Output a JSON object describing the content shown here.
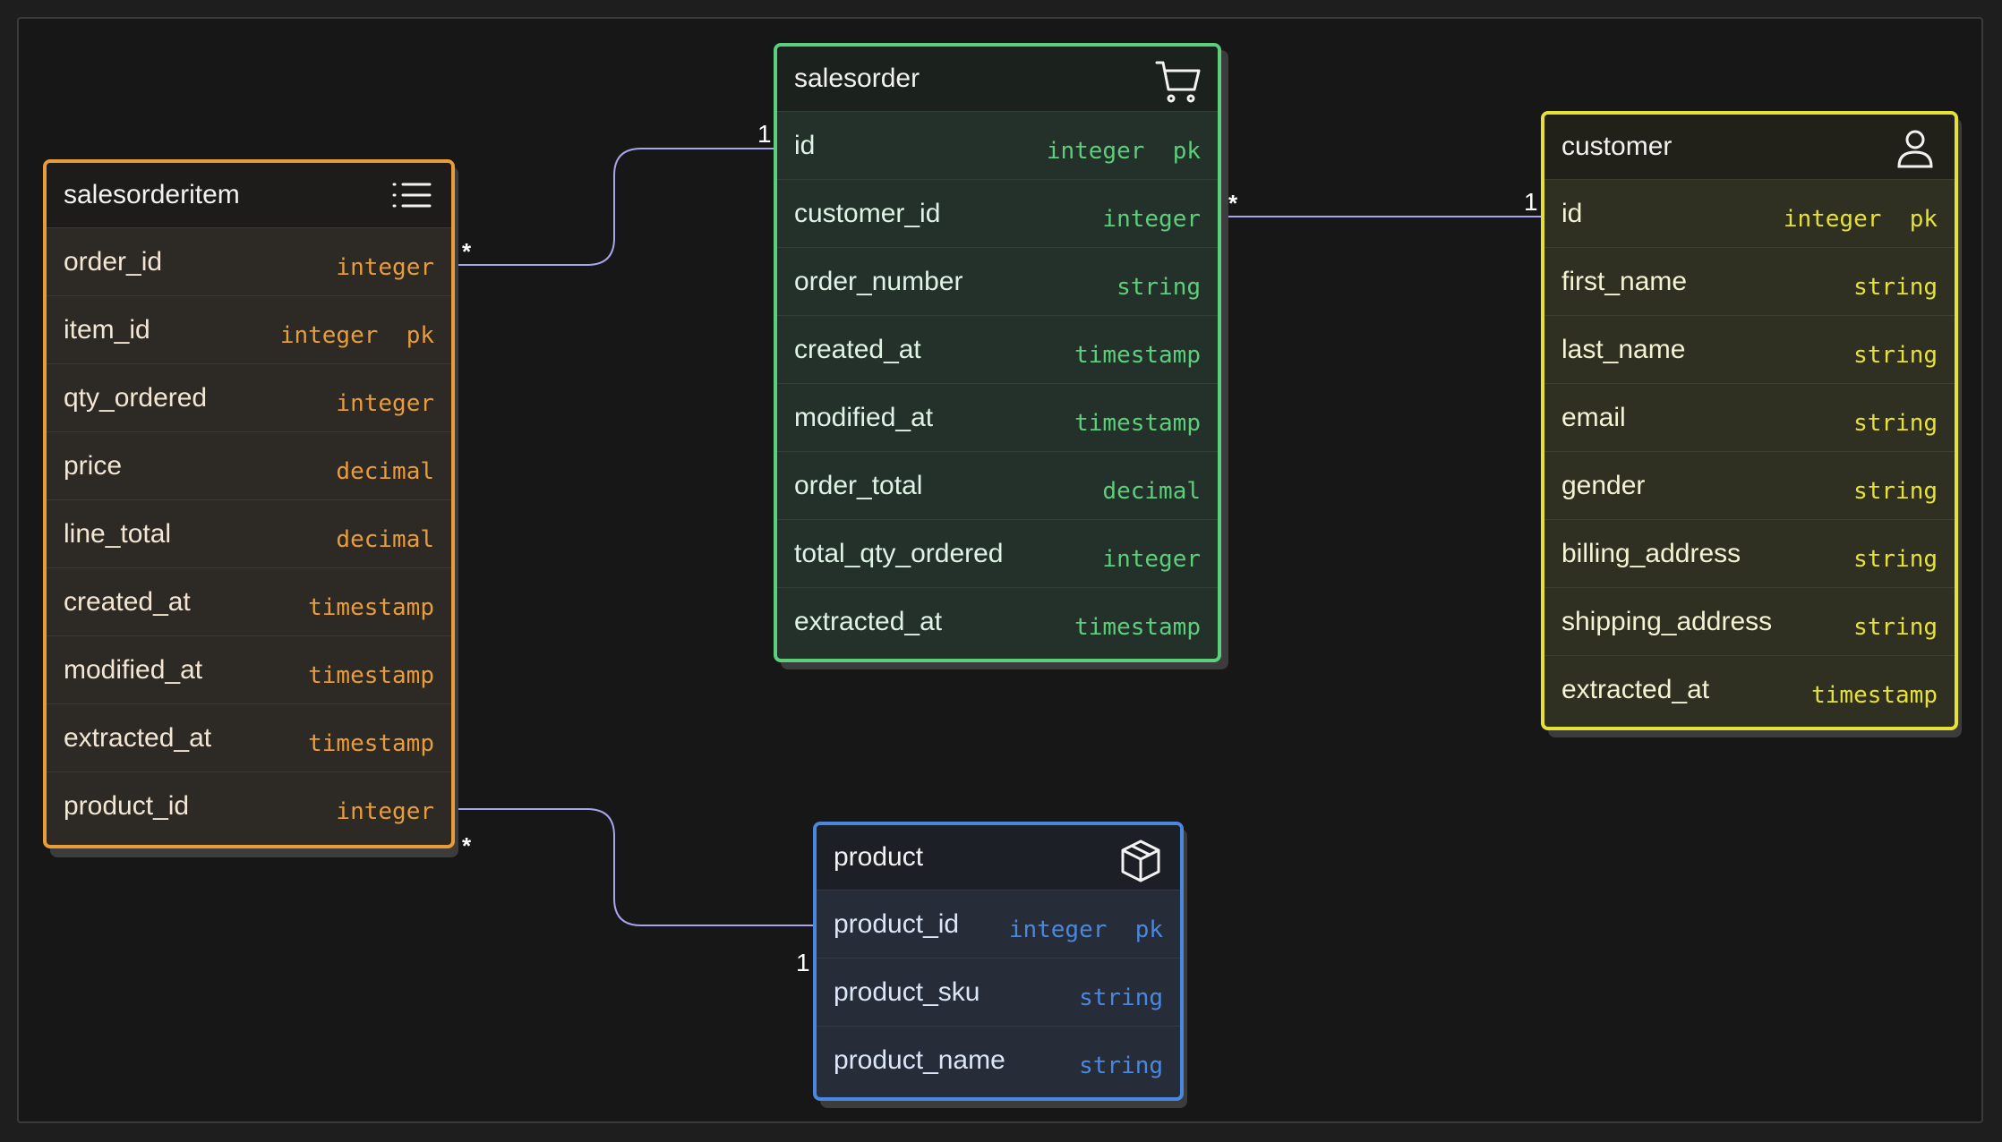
{
  "tables": {
    "salesorderitem": {
      "name": "salesorderitem",
      "icon": "list-icon",
      "color": "#e99c3a",
      "fields": [
        {
          "name": "order_id",
          "type": "integer"
        },
        {
          "name": "item_id",
          "type": "integer  pk"
        },
        {
          "name": "qty_ordered",
          "type": "integer"
        },
        {
          "name": "price",
          "type": "decimal"
        },
        {
          "name": "line_total",
          "type": "decimal"
        },
        {
          "name": "created_at",
          "type": "timestamp"
        },
        {
          "name": "modified_at",
          "type": "timestamp"
        },
        {
          "name": "extracted_at",
          "type": "timestamp"
        },
        {
          "name": "product_id",
          "type": "integer"
        }
      ]
    },
    "salesorder": {
      "name": "salesorder",
      "icon": "cart-icon",
      "color": "#5bcf79",
      "fields": [
        {
          "name": "id",
          "type": "integer  pk"
        },
        {
          "name": "customer_id",
          "type": "integer"
        },
        {
          "name": "order_number",
          "type": "string"
        },
        {
          "name": "created_at",
          "type": "timestamp"
        },
        {
          "name": "modified_at",
          "type": "timestamp"
        },
        {
          "name": "order_total",
          "type": "decimal"
        },
        {
          "name": "total_qty_ordered",
          "type": "integer"
        },
        {
          "name": "extracted_at",
          "type": "timestamp"
        }
      ]
    },
    "customer": {
      "name": "customer",
      "icon": "user-icon",
      "color": "#e6e235",
      "fields": [
        {
          "name": "id",
          "type": "integer  pk"
        },
        {
          "name": "first_name",
          "type": "string"
        },
        {
          "name": "last_name",
          "type": "string"
        },
        {
          "name": "email",
          "type": "string"
        },
        {
          "name": "gender",
          "type": "string"
        },
        {
          "name": "billing_address",
          "type": "string"
        },
        {
          "name": "shipping_address",
          "type": "string"
        },
        {
          "name": "extracted_at",
          "type": "timestamp"
        }
      ]
    },
    "product": {
      "name": "product",
      "icon": "box-icon",
      "color": "#4a88e0",
      "fields": [
        {
          "name": "product_id",
          "type": "integer  pk"
        },
        {
          "name": "product_sku",
          "type": "string"
        },
        {
          "name": "product_name",
          "type": "string"
        }
      ]
    }
  },
  "relations": [
    {
      "from": "salesorderitem.order_id",
      "to": "salesorder.id",
      "from_label": "*",
      "to_label": "1"
    },
    {
      "from": "salesorder.customer_id",
      "to": "customer.id",
      "from_label": "*",
      "to_label": "1"
    },
    {
      "from": "salesorderitem.product_id",
      "to": "product.product_id",
      "from_label": "*",
      "to_label": "1"
    }
  ],
  "edge_color": "#a8a4f0"
}
